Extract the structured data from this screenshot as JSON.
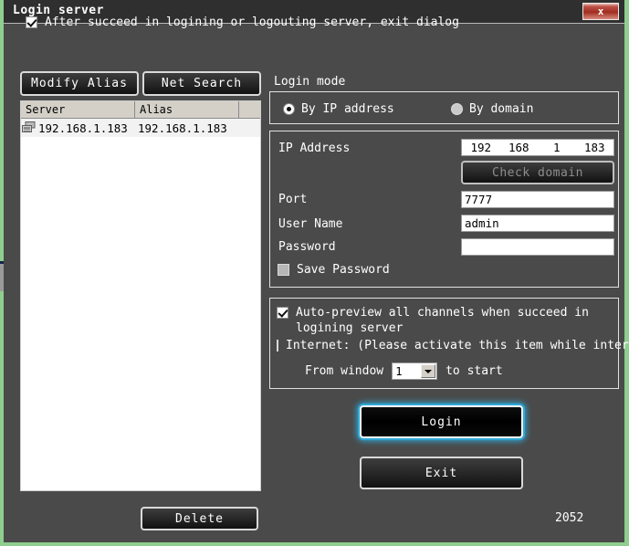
{
  "window": {
    "title": "Login server",
    "close_label": "x"
  },
  "options_top": {
    "exit_dialog_label": "After succeed in logining or logouting server, exit dialog",
    "exit_dialog_checked": true
  },
  "left_pane": {
    "modify_alias_label": "Modify Alias",
    "net_search_label": "Net Search",
    "delete_label": "Delete",
    "list": {
      "columns": [
        "Server",
        "Alias",
        ""
      ],
      "rows": [
        {
          "icon": "server-icon",
          "server": "192.168.1.183",
          "alias": "192.168.1.183"
        }
      ]
    }
  },
  "login_mode": {
    "group_label": "Login mode",
    "by_ip_label": "By IP address",
    "by_domain_label": "By domain",
    "selected": "by_ip"
  },
  "credentials": {
    "ip_label": "IP Address",
    "ip_segments": [
      "192",
      "168",
      "1",
      "183"
    ],
    "check_domain_label": "Check domain",
    "check_domain_enabled": false,
    "port_label": "Port",
    "port_value": "7777",
    "user_label": "User Name",
    "user_value": "admin",
    "password_label": "Password",
    "password_value": "",
    "save_password_label": "Save Password",
    "save_password_checked": false
  },
  "options": {
    "auto_preview_label": "Auto-preview all channels when succeed in logining server",
    "auto_preview_checked": true,
    "internet_label": "Internet: (Please activate this item while interne",
    "internet_checked": false,
    "from_window_label": "From window",
    "window_value": "1",
    "to_start_label": "to start"
  },
  "actions": {
    "login_label": "Login",
    "exit_label": "Exit"
  },
  "status": {
    "version": "2052"
  },
  "colors": {
    "desktop": "#8fce8f",
    "dialog_bg": "#4a4a4a",
    "titlebar_bg": "#2f2f2f",
    "close_red": "#a02d20",
    "focus_glow": "#2fa8d8",
    "field_bg": "#ffffff"
  }
}
